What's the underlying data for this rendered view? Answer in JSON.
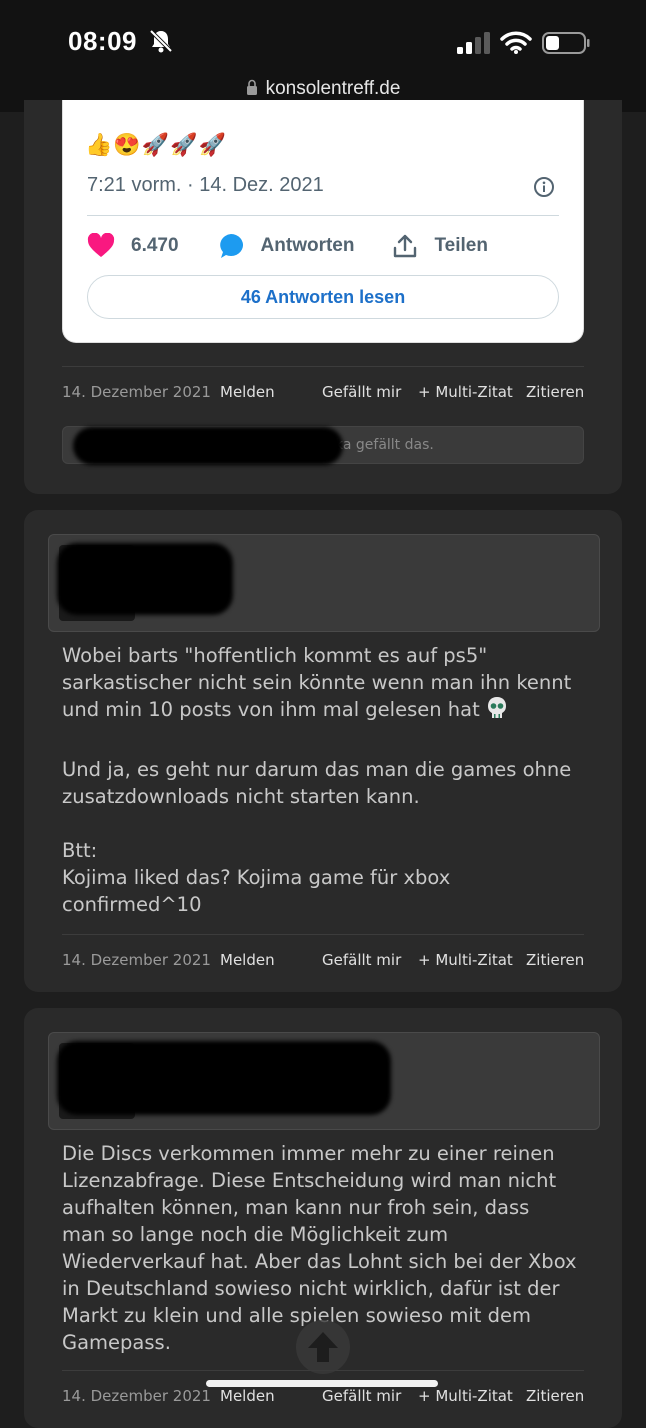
{
  "status_bar": {
    "time": "08:09",
    "url": "konsolentreff.de"
  },
  "tweet": {
    "emojis": "👍😍🚀🚀🚀",
    "timestamp": "7:21 vorm. · 14. Dez. 2021",
    "likes": "6.470",
    "reply_label": "Antworten",
    "share_label": "Teilen",
    "read_replies": "46 Antworten lesen",
    "colors": {
      "heart": "#f91880",
      "reply": "#1d9bf0",
      "link": "#1d70c9"
    }
  },
  "posts": [
    {
      "footer": {
        "date": "14. Dezember 2021",
        "report": "Melden",
        "like": "Gefällt mir",
        "multi_quote": "+ Multi-Zitat",
        "quote": "Zitieren"
      },
      "liked_by_suffix": "ka gefällt das."
    },
    {
      "text": "Wobei barts \"hoffentlich kommt es auf ps5\"\nsarkastischer nicht sein könnte wenn man ihn kennt\nund min 10 posts von ihm mal gelesen hat",
      "text2": "Und ja, es geht nur darum das man die games ohne\nzusatzdownloads nicht starten kann.\n\nBtt:\nKojima liked das? Kojima game für xbox\nconfirmed^10",
      "footer": {
        "date": "14. Dezember 2021",
        "report": "Melden",
        "like": "Gefällt mir",
        "multi_quote": "+ Multi-Zitat",
        "quote": "Zitieren"
      }
    },
    {
      "text": "Die Discs verkommen immer mehr zu einer reinen\nLizenzabfrage. Diese Entscheidung wird man nicht\naufhalten können, man kann nur froh sein, dass\nman so lange noch die Möglichkeit zum\nWiederverkauf hat. Aber das Lohnt sich bei der Xbox\nin Deutschland sowieso nicht wirklich, dafür ist der\nMarkt zu klein und alle spielen sowieso mit dem\nGamepass.",
      "footer": {
        "date": "14. Dezember 2021",
        "report": "Melden",
        "like": "Gefällt mir",
        "multi_quote": "+ Multi-Zitat",
        "quote": "Zitieren"
      }
    }
  ]
}
